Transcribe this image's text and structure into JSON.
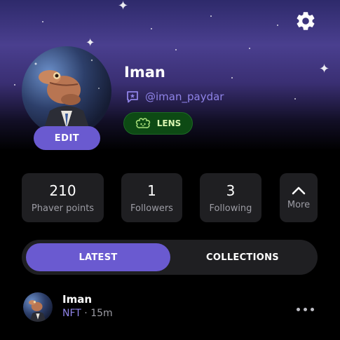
{
  "profile": {
    "name": "Iman",
    "handle": "@iman_paydar",
    "edit_label": "EDIT",
    "badge_label": "LENS"
  },
  "stats": [
    {
      "value": "210",
      "label": "Phaver points"
    },
    {
      "value": "1",
      "label": "Followers"
    },
    {
      "value": "3",
      "label": "Following"
    }
  ],
  "more_label": "More",
  "tabs": {
    "active": "LATEST",
    "inactive": "COLLECTIONS"
  },
  "post": {
    "author": "Iman",
    "tag": "NFT",
    "separator": "·",
    "time": "15m"
  },
  "icons": {
    "settings": "gear-icon",
    "handle": "chat-star-icon",
    "badge": "lens-icon",
    "more": "chevron-up-icon",
    "post_menu": "more-horizontal-icon"
  },
  "colors": {
    "accent": "#6a5ad0",
    "handle": "#8f83e8",
    "lens_bg": "#0d4a14",
    "card_bg": "#1f1f22"
  }
}
